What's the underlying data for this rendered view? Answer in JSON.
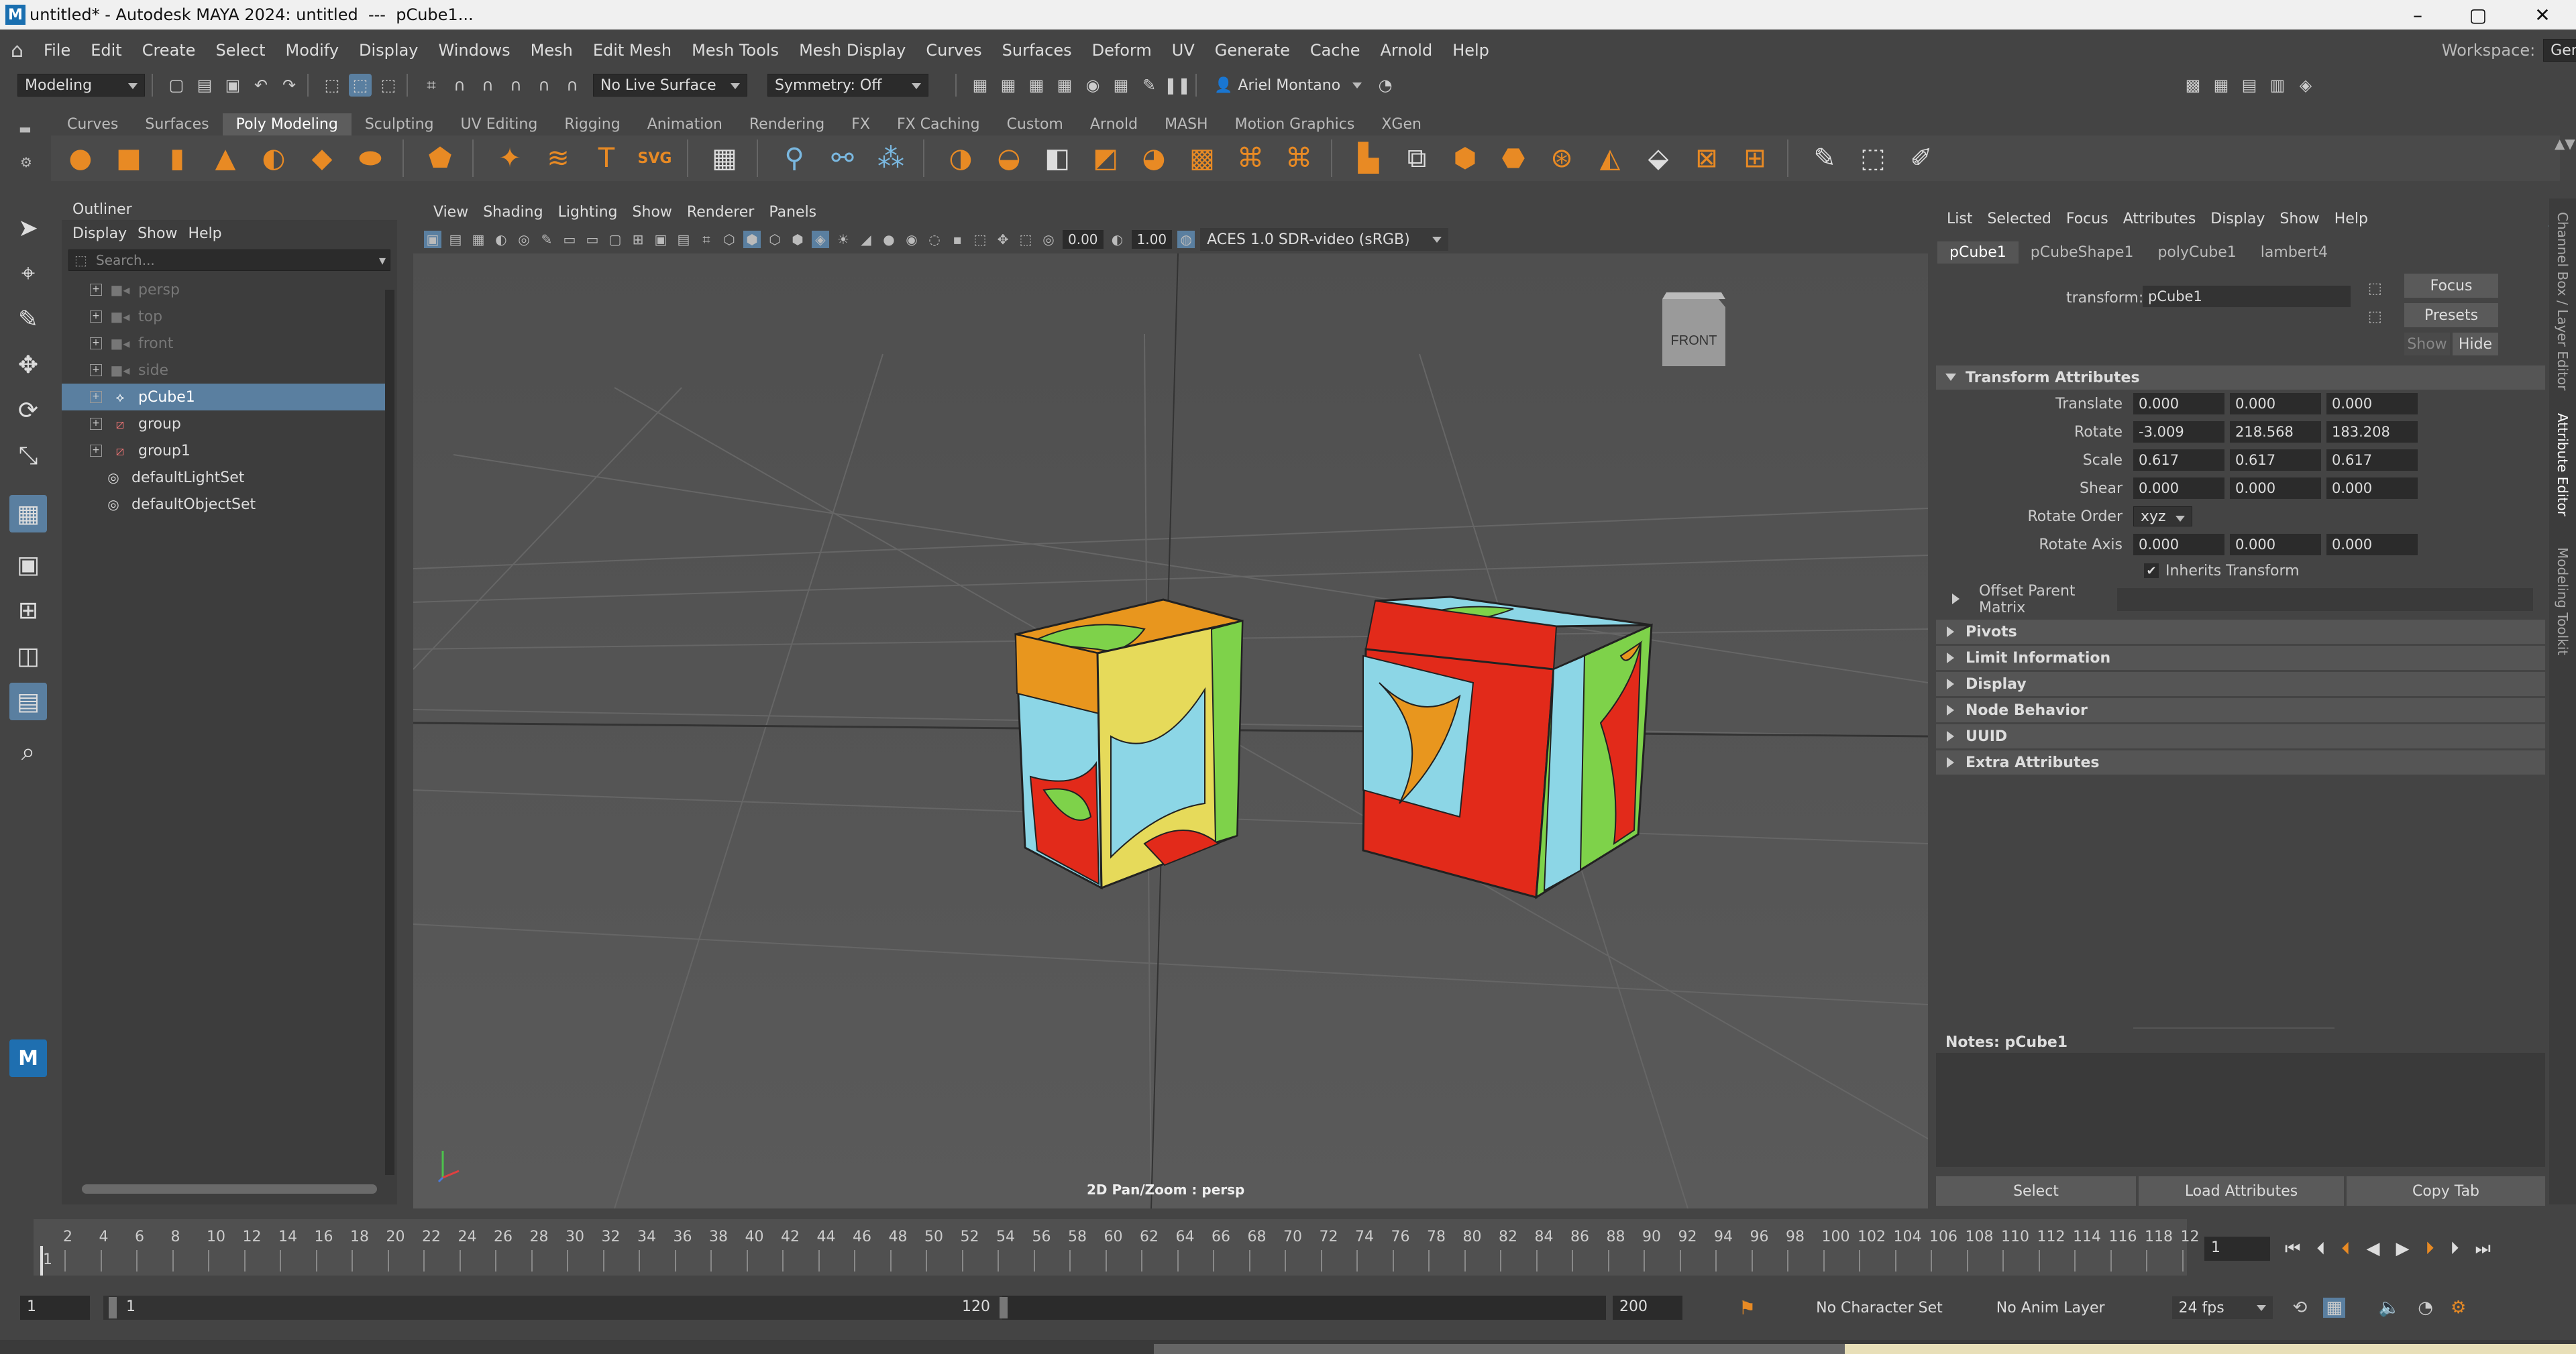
{
  "titlebar": {
    "title": "untitled* - Autodesk MAYA 2024: untitled  ---  pCube1...",
    "min": "–",
    "max": "▢",
    "close": "✕"
  },
  "menubar": {
    "items": [
      "File",
      "Edit",
      "Create",
      "Select",
      "Modify",
      "Display",
      "Windows",
      "Mesh",
      "Edit Mesh",
      "Mesh Tools",
      "Mesh Display",
      "Curves",
      "Surfaces",
      "Deform",
      "UV",
      "Generate",
      "Cache",
      "Arnold",
      "Help"
    ],
    "workspace_label": "Workspace:",
    "workspace_value": "General*"
  },
  "statusline": {
    "mode": "Modeling",
    "live_surface": "No Live Surface",
    "symmetry": "Symmetry: Off",
    "user": "Ariel Montano"
  },
  "shelf": {
    "tabs": [
      "Curves",
      "Surfaces",
      "Poly Modeling",
      "Sculpting",
      "UV Editing",
      "Rigging",
      "Animation",
      "Rendering",
      "FX",
      "FX Caching",
      "Custom",
      "Arnold",
      "MASH",
      "Motion Graphics",
      "XGen"
    ],
    "active": "Poly Modeling"
  },
  "outliner": {
    "title": "Outliner",
    "menu": [
      "Display",
      "Show",
      "Help"
    ],
    "search_placeholder": "Search...",
    "items": [
      {
        "label": "persp",
        "dim": true
      },
      {
        "label": "top",
        "dim": true
      },
      {
        "label": "front",
        "dim": true
      },
      {
        "label": "side",
        "dim": true
      },
      {
        "label": "pCube1",
        "selected": true
      },
      {
        "label": "group"
      },
      {
        "label": "group1"
      },
      {
        "label": "defaultLightSet"
      },
      {
        "label": "defaultObjectSet"
      }
    ]
  },
  "viewport": {
    "menu": [
      "View",
      "Shading",
      "Lighting",
      "Show",
      "Renderer",
      "Panels"
    ],
    "value1": "0.00",
    "value2": "1.00",
    "colorspace": "ACES 1.0 SDR-video (sRGB)",
    "viewcube": "FRONT",
    "pan_label": "2D Pan/Zoom : persp"
  },
  "attribute_editor": {
    "menu": [
      "List",
      "Selected",
      "Focus",
      "Attributes",
      "Display",
      "Show",
      "Help"
    ],
    "tabs": [
      "pCube1",
      "pCubeShape1",
      "polyCube1",
      "lambert4"
    ],
    "transform_label": "transform:",
    "transform_value": "pCube1",
    "buttons": {
      "focus": "Focus",
      "presets": "Presets",
      "show": "Show",
      "hide": "Hide"
    },
    "section_transform": "Transform Attributes",
    "translate": {
      "label": "Translate",
      "v": [
        "0.000",
        "0.000",
        "0.000"
      ]
    },
    "rotate": {
      "label": "Rotate",
      "v": [
        "-3.009",
        "218.568",
        "183.208"
      ]
    },
    "scale": {
      "label": "Scale",
      "v": [
        "0.617",
        "0.617",
        "0.617"
      ]
    },
    "shear": {
      "label": "Shear",
      "v": [
        "0.000",
        "0.000",
        "0.000"
      ]
    },
    "rotate_order": {
      "label": "Rotate Order",
      "value": "xyz"
    },
    "rotate_axis": {
      "label": "Rotate Axis",
      "v": [
        "0.000",
        "0.000",
        "0.000"
      ]
    },
    "inherits": "Inherits Transform",
    "offset": "Offset Parent Matrix",
    "sections": [
      "Pivots",
      "Limit Information",
      "Display",
      "Node Behavior",
      "UUID",
      "Extra Attributes"
    ],
    "notes": "Notes:  pCube1",
    "bottom_buttons": [
      "Select",
      "Load Attributes",
      "Copy Tab"
    ]
  },
  "sidetabs": [
    "Channel Box / Layer Editor",
    "Attribute Editor",
    "Modeling Toolkit"
  ],
  "timeline": {
    "ticks": [
      "2",
      "4",
      "6",
      "8",
      "10",
      "12",
      "14",
      "16",
      "18",
      "20",
      "22",
      "24",
      "26",
      "28",
      "30",
      "32",
      "34",
      "36",
      "38",
      "40",
      "42",
      "44",
      "46",
      "48",
      "50",
      "52",
      "54",
      "56",
      "58",
      "60",
      "62",
      "64",
      "66",
      "68",
      "70",
      "72",
      "74",
      "76",
      "78",
      "80",
      "82",
      "84",
      "86",
      "88",
      "90",
      "92",
      "94",
      "96",
      "98",
      "100",
      "102",
      "104",
      "106",
      "108",
      "110",
      "112",
      "114",
      "116",
      "118",
      "12"
    ],
    "start_marker": "1",
    "current_frame": "1"
  },
  "range": {
    "start": "1",
    "inner_start": "1",
    "inner_end": "120",
    "end": "200",
    "char_set": "No Character Set",
    "anim_layer": "No Anim Layer",
    "fps": "24 fps"
  },
  "colors": {
    "orange": "#e8961e",
    "yellow": "#e6da5a",
    "cyan": "#8cd6e6",
    "red": "#e22a1a",
    "green": "#7ed24a"
  }
}
